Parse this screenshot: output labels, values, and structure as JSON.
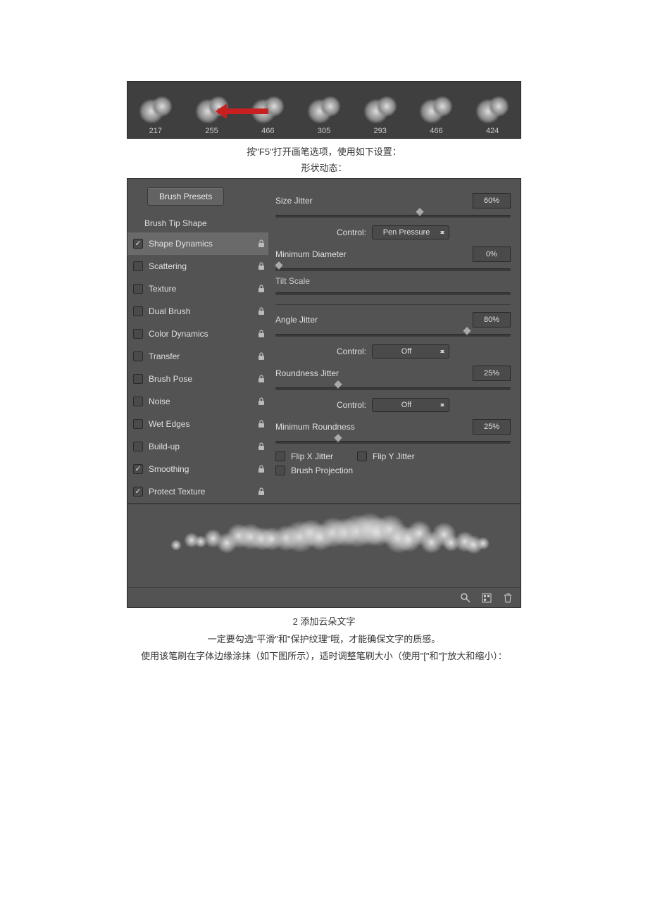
{
  "brush_strip": [
    "217",
    "255",
    "466",
    "305",
    "293",
    "466",
    "424"
  ],
  "captions": {
    "line1": "按\"F5\"打开画笔选项，使用如下设置：",
    "line2": "形状动态："
  },
  "panel": {
    "presets_button": "Brush Presets",
    "tip_shape": "Brush Tip Shape",
    "options": [
      {
        "label": "Shape Dynamics",
        "checked": true,
        "active": true
      },
      {
        "label": "Scattering",
        "checked": false
      },
      {
        "label": "Texture",
        "checked": false
      },
      {
        "label": "Dual Brush",
        "checked": false
      },
      {
        "label": "Color Dynamics",
        "checked": false
      },
      {
        "label": "Transfer",
        "checked": false
      },
      {
        "label": "Brush Pose",
        "checked": false
      },
      {
        "label": "Noise",
        "checked": false
      },
      {
        "label": "Wet Edges",
        "checked": false
      },
      {
        "label": "Build-up",
        "checked": false
      },
      {
        "label": "Smoothing",
        "checked": true
      },
      {
        "label": "Protect Texture",
        "checked": true
      }
    ],
    "params": {
      "size_jitter": {
        "label": "Size Jitter",
        "value": "60%",
        "pos": 60,
        "control_label": "Control:",
        "control_value": "Pen Pressure"
      },
      "min_diameter": {
        "label": "Minimum Diameter",
        "value": "0%",
        "pos": 0
      },
      "tilt_scale": {
        "label": "Tilt Scale",
        "value": "",
        "pos": 0
      },
      "angle_jitter": {
        "label": "Angle Jitter",
        "value": "80%",
        "pos": 80,
        "control_label": "Control:",
        "control_value": "Off"
      },
      "roundness_jitter": {
        "label": "Roundness Jitter",
        "value": "25%",
        "pos": 25,
        "control_label": "Control:",
        "control_value": "Off"
      },
      "min_roundness": {
        "label": "Minimum Roundness",
        "value": "25%",
        "pos": 25
      },
      "flip_x": "Flip X Jitter",
      "flip_y": "Flip Y Jitter",
      "brush_projection": "Brush Projection"
    }
  },
  "footer_text": {
    "step": "2 添加云朵文字",
    "line1": "一定要勾选\"平滑\"和\"保护纹理\"哦，才能确保文字的质感。",
    "line2": "使用该笔刷在字体边缘涂抹（如下图所示），适时调整笔刷大小（使用\"[\"和\"]\"放大和缩小）："
  }
}
